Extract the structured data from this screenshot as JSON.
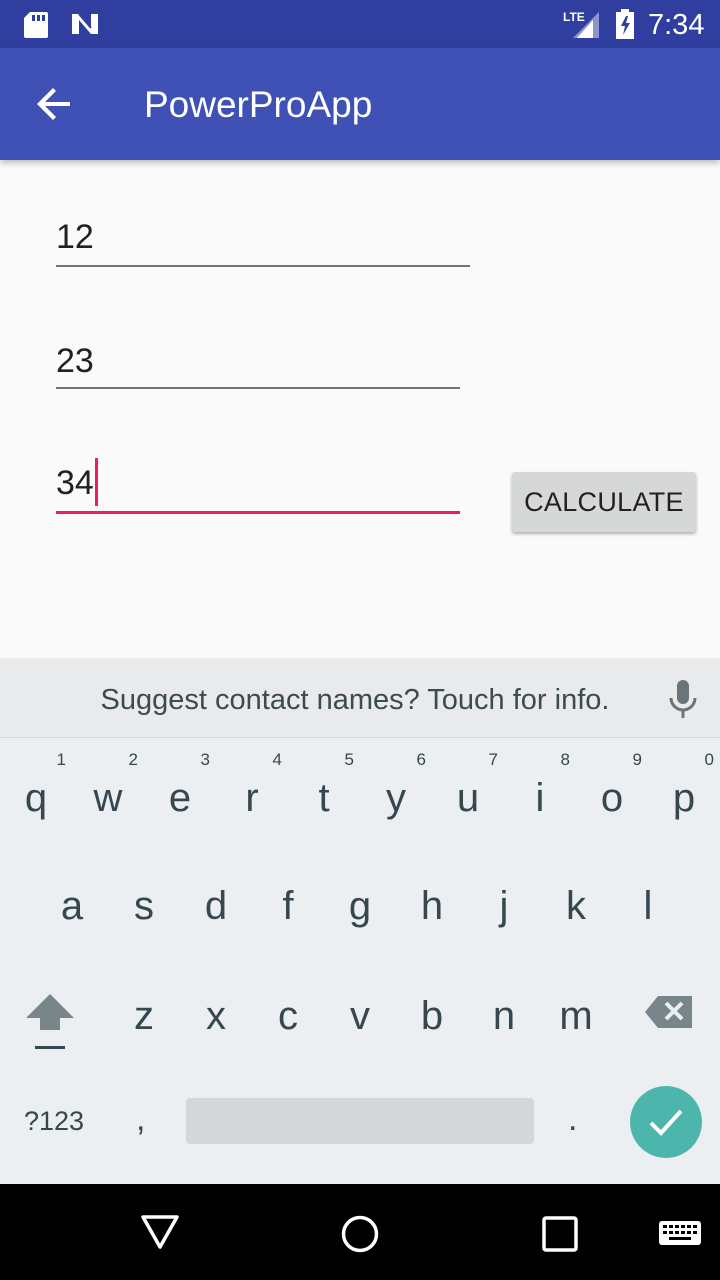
{
  "status_bar": {
    "time": "7:34",
    "network_label": "LTE",
    "icons": [
      "sd-card-icon",
      "n-notification-icon",
      "lte-signal-icon",
      "battery-charging-icon"
    ]
  },
  "app_bar": {
    "title": "PowerProApp",
    "back_icon": "arrow-back-icon",
    "color": "#3f51b5",
    "status_color": "#303f9f"
  },
  "form": {
    "field1_value": "12",
    "field2_value": "23",
    "field3_value": "34",
    "focus_color": "#e91e63",
    "calculate_label": "CALCULATE"
  },
  "keyboard": {
    "suggestion": "Suggest contact names? Touch for info.",
    "row1": [
      {
        "key": "q",
        "hint": "1"
      },
      {
        "key": "w",
        "hint": "2"
      },
      {
        "key": "e",
        "hint": "3"
      },
      {
        "key": "r",
        "hint": "4"
      },
      {
        "key": "t",
        "hint": "5"
      },
      {
        "key": "y",
        "hint": "6"
      },
      {
        "key": "u",
        "hint": "7"
      },
      {
        "key": "i",
        "hint": "8"
      },
      {
        "key": "o",
        "hint": "9"
      },
      {
        "key": "p",
        "hint": "0"
      }
    ],
    "row2": [
      "a",
      "s",
      "d",
      "f",
      "g",
      "h",
      "j",
      "k",
      "l"
    ],
    "row3": [
      "z",
      "x",
      "c",
      "v",
      "b",
      "n",
      "m"
    ],
    "symbols_label": "?123",
    "comma": ",",
    "period": ".",
    "enter_color": "#4db6ac"
  },
  "nav_bar": {
    "icons": [
      "back-triangle-icon",
      "home-circle-icon",
      "recents-square-icon",
      "keyboard-switch-icon"
    ]
  }
}
